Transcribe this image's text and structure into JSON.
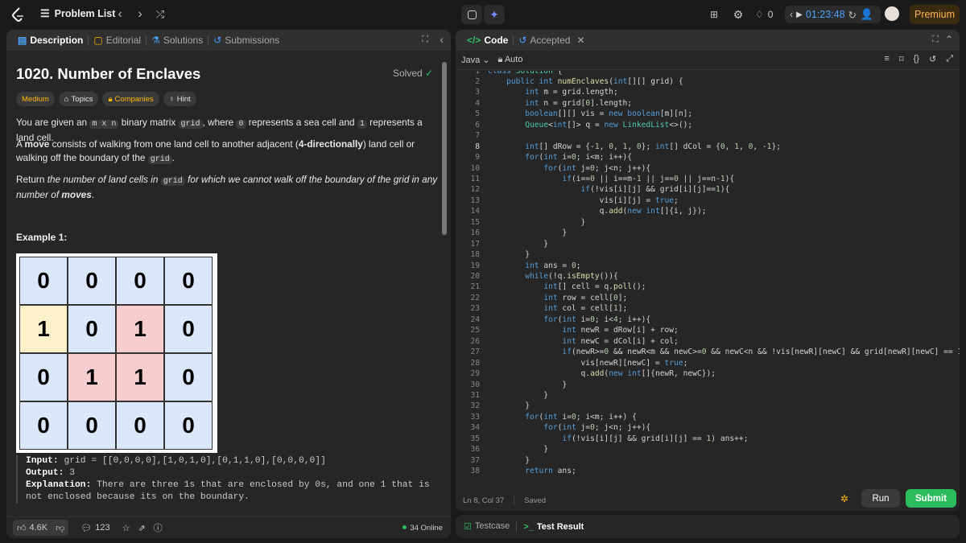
{
  "topbar": {
    "problem_list": "Problem List",
    "streak": "0",
    "timer": "01:23:48",
    "premium": "Premium"
  },
  "left": {
    "tabs": [
      "Description",
      "Editorial",
      "Solutions",
      "Submissions"
    ],
    "title": "1020. Number of Enclaves",
    "solved": "Solved",
    "chips": [
      "Medium",
      "Topics",
      "Companies",
      "Hint"
    ],
    "p1a": "You are given an ",
    "p1code1": "m x n",
    "p1b": " binary matrix ",
    "p1code2": "grid",
    "p1c": ", where ",
    "p1code3": "0",
    "p1d": " represents a sea cell and ",
    "p1code4": "1",
    "p1e": " represents a land cell.",
    "p2a": "A ",
    "p2b": "move",
    "p2c": " consists of walking from one land cell to another adjacent (",
    "p2d": "4-directionally",
    "p2e": ") land cell or walking off the boundary of the ",
    "p2code": "grid",
    "p2f": ".",
    "p3a": "Return ",
    "p3b": "the number of land cells in ",
    "p3code": "grid",
    "p3c": " for which we cannot walk off the boundary of the grid in any number of ",
    "p3d": "moves",
    "p3e": ".",
    "example_title": "Example 1:",
    "grid": [
      [
        "0",
        "0",
        "0",
        "0"
      ],
      [
        "1",
        "0",
        "1",
        "0"
      ],
      [
        "0",
        "1",
        "1",
        "0"
      ],
      [
        "0",
        "0",
        "0",
        "0"
      ]
    ],
    "input_label": "Input:",
    "input_val": " grid = [[0,0,0,0],[1,0,1,0],[0,1,1,0],[0,0,0,0]]",
    "output_label": "Output:",
    "output_val": " 3",
    "expl_label": "Explanation:",
    "expl_val": " There are three 1s that are enclosed by 0s, and one 1 that is not enclosed because its on the boundary.",
    "likes": "4.6K",
    "comments": "123",
    "online": "34 Online"
  },
  "right": {
    "tab_code": "Code",
    "tab_accepted": "Accepted",
    "lang": "Java",
    "auto": "Auto",
    "status_pos": "Ln 8, Col 37",
    "status_saved": "Saved",
    "run": "Run",
    "submit": "Submit",
    "testcase": "Testcase",
    "testresult": "Test Result"
  },
  "colors": {
    "accent": "#2cbb5d",
    "medium": "#ffb800",
    "timer": "#4aa3ff",
    "premium": "#ffb74d"
  }
}
